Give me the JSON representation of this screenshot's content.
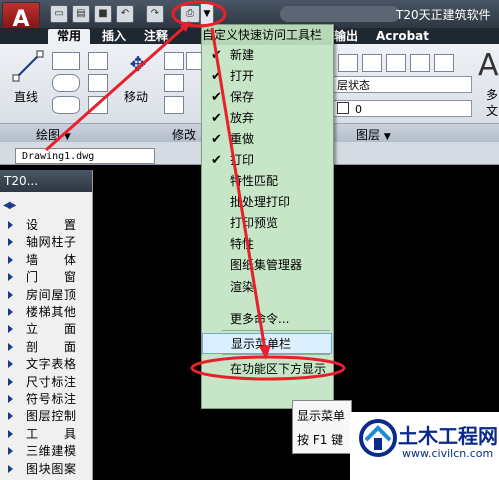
{
  "titlebar": {
    "app_logo": "A",
    "title": "T20天正建筑软件"
  },
  "ribbon": {
    "tabs": [
      "常用",
      "插入",
      "注释",
      "输出",
      "Acrobat"
    ],
    "draw": {
      "line_label": "直线",
      "panel_label": "绘图",
      "panel_arrow": "▼"
    },
    "modify": {
      "move_label": "移动",
      "panel_label": "修改"
    },
    "layers": {
      "layer_state": "层状态",
      "layer_value": "0",
      "panel_label": "图层",
      "panel_arrow": "▼"
    },
    "right_edge": {
      "big_letter": "A",
      "text1": "多",
      "text2": "文"
    }
  },
  "document": {
    "tab_label": "Drawing1.dwg"
  },
  "tool_panel": {
    "title": "T20...",
    "items": [
      "设　置",
      "轴网柱子",
      "墙　体",
      "门　窗",
      "房间屋顶",
      "楼梯其他",
      "立　面",
      "剖　面",
      "文字表格",
      "尺寸标注",
      "符号标注",
      "图层控制",
      "工　具",
      "三维建模",
      "图块图案"
    ]
  },
  "menu": {
    "header": "自定义快速访问工具栏",
    "items": [
      {
        "label": "新建",
        "checked": true
      },
      {
        "label": "打开",
        "checked": true
      },
      {
        "label": "保存",
        "checked": true
      },
      {
        "label": "放弃",
        "checked": true
      },
      {
        "label": "重做",
        "checked": true
      },
      {
        "label": "打印",
        "checked": true
      },
      {
        "label": "特性匹配",
        "checked": false
      },
      {
        "label": "批处理打印",
        "checked": false
      },
      {
        "label": "打印预览",
        "checked": false
      },
      {
        "label": "特性",
        "checked": false
      },
      {
        "label": "图纸集管理器",
        "checked": false
      },
      {
        "label": "渲染",
        "checked": false
      },
      {
        "label": "更多命令...",
        "checked": false
      },
      {
        "label": "显示菜单栏",
        "checked": false
      },
      {
        "label": "在功能区下方显示",
        "checked": false
      }
    ],
    "check_glyph": "✔"
  },
  "tooltip": {
    "line1": "显示菜单",
    "line2": "按 F1 键"
  },
  "watermark": {
    "name": "土木工程网",
    "url": "www.civilcn.com"
  },
  "colors": {
    "annotation_red": "#e8202a",
    "menu_bg": "#c7e6c7",
    "highlight": "#dcefff"
  }
}
